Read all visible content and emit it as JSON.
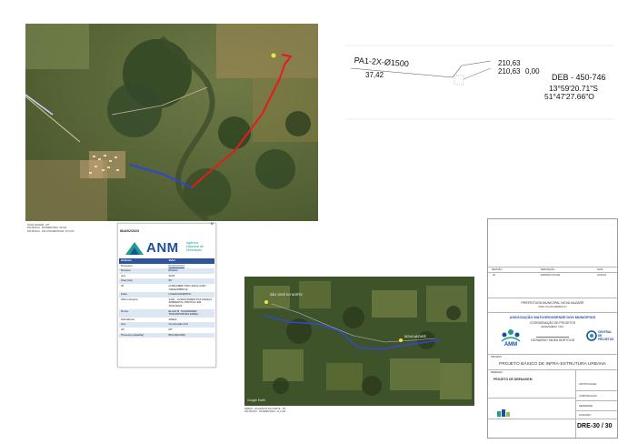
{
  "map1": {
    "caption_lines": [
      "NOVA NAZARÉ - MT",
      "DISTÂNCIA - PAVIMENTADA: 25 KM",
      "DISTÂNCIA - NÃO PAVIMENTADA: 16,6 KM"
    ]
  },
  "cad": {
    "pipe_label": "PA1-2X-Ø1500",
    "length": "37,42",
    "elev_top": "210,63",
    "elev_bottom": "210,63",
    "elev_offset": "0,00",
    "deb_code": "DEB - 450-746",
    "latitude": "13°59'20.71\"S",
    "longitude": "51°47'27.66\"O"
  },
  "anm": {
    "popup_title": "864202/2023",
    "close_symbol": "×",
    "brand": "ANM",
    "agency_lines": [
      "Agência",
      "Nacional de",
      "Mineração"
    ],
    "table_headers": [
      "Atributo",
      "Valor"
    ],
    "rows": [
      {
        "k": "Processo",
        "v": "864202/2023",
        "link": true
      },
      {
        "k": "Número",
        "v": "864202"
      },
      {
        "k": "Ano",
        "v": "2023"
      },
      {
        "k": "Área (ha)",
        "v": "50"
      },
      {
        "k": "ID",
        "v": "{A1B4A8EB-7MIC-49CA-A4D7-C6E0218B6C2}"
      },
      {
        "k": "Fase",
        "v": "LICENCIAMENTO"
      },
      {
        "k": "Último Evento",
        "v": "1401 - LICENCIAMENTO/LICENÇA AMBIENTAL PROTOC EM 15/11/2023"
      },
      {
        "k": "Nome",
        "v": "ELAIO B. SCHNEIDER TRANSPORTES EIRELI"
      },
      {
        "k": "Substância",
        "v": "AREIA"
      },
      {
        "k": "Uso",
        "v": "Construção civil"
      },
      {
        "k": "UF",
        "v": "MT"
      },
      {
        "k": "Processo (detalhe)",
        "v": "864.202/2023"
      }
    ]
  },
  "map2": {
    "label_north": "SÃO JOSÉ DO NORTE",
    "label_east": "NOVA NAZARÉ",
    "watermark": "Google Earth",
    "caption_lines": [
      "DEBAS - QUARANTA DO NORTE - MT",
      "DISTÂNCIA - PAVIMENTADA: 41,4 KM"
    ]
  },
  "titleblock": {
    "revision_headers": [
      "REVISÃO",
      "DESCRIÇÃO",
      "DATA"
    ],
    "revision_row": [
      "00",
      "EMISSÃO INICIAL",
      "22/11/23"
    ],
    "prefeitura": "PREFEITURA MUNICIPAL NOVA NAZARÉ",
    "prefeitura_sub": "CNPJ: 04.215.228/0001-17",
    "association": "ASSOCIAÇÃO MATOGROSSENSE DOS MUNICÍPIOS",
    "coordination": "COORDENAÇÃO DE PROJETOS",
    "coordination_sub": "ENGENHEIRO CIVIL",
    "engineer": "LEONARDO TADEU BORTOLIN",
    "logo_left": "AMM",
    "logo_right_lines": [
      "CENTRAL DE",
      "PROJETOS"
    ],
    "project_label": "PROJETO",
    "project_title": "PROJETO BÁSICO DE INFRA-ESTRUTURA URBANA",
    "drawing_label": "DESENHO",
    "drawing_title": "PROJETO DE DRENAGEM",
    "side_fields": [
      "INSTITUCIONAL",
      "COMUNICAÇÃO",
      "DENSIDADE",
      "22/11/2023"
    ],
    "sheet_number": "DRE-30 / 30"
  },
  "colors": {
    "route_paved": "#e21c1c",
    "route_unpaved": "#2f44d8",
    "table_header": "#2f5597",
    "table_alt_row": "#dde6f3",
    "anm_teal": "#1b9e8f",
    "anm_blue": "#1f4e9c"
  }
}
